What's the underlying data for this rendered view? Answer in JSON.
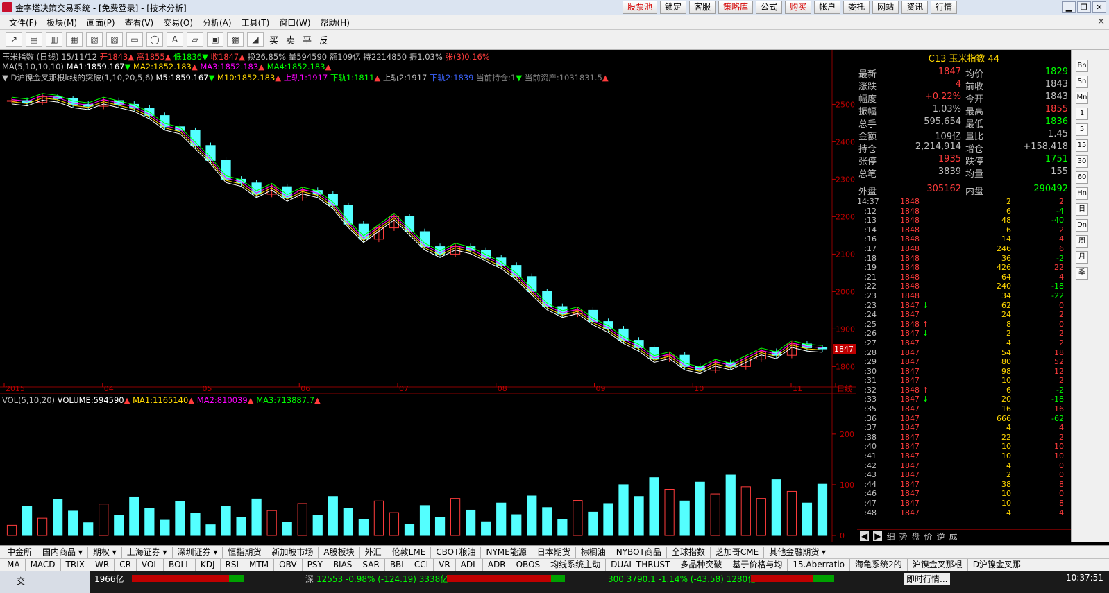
{
  "window": {
    "title": "金字塔决策交易系统 - [免费登录] - [技术分析]",
    "top_buttons": [
      {
        "label": "股票池",
        "red": true
      },
      {
        "label": "锁定",
        "red": false
      },
      {
        "label": "客服",
        "red": false
      },
      {
        "label": "策略库",
        "red": true
      },
      {
        "label": "公式",
        "red": false
      },
      {
        "label": "购买",
        "red": true
      },
      {
        "label": "帐户",
        "red": false
      },
      {
        "label": "委托",
        "red": false
      },
      {
        "label": "网站",
        "red": false
      },
      {
        "label": "资讯",
        "red": false
      },
      {
        "label": "行情",
        "red": false
      }
    ],
    "controls": [
      "▁",
      "❐",
      "✕"
    ]
  },
  "menu": [
    "文件(F)",
    "板块(M)",
    "画面(P)",
    "查看(V)",
    "交易(O)",
    "分析(A)",
    "工具(T)",
    "窗口(W)",
    "帮助(H)"
  ],
  "toolbar": {
    "trade_labels": [
      "买",
      "卖",
      "平",
      "反"
    ]
  },
  "chart_header": {
    "line1": [
      {
        "t": "玉米指数 (日线) 15/11/12 ",
        "c": "#c0c0c0"
      },
      {
        "t": "开1843",
        "c": "#ff3c3c"
      },
      {
        "t": "▲ ",
        "c": "#ff3c3c"
      },
      {
        "t": "高1855",
        "c": "#ff3c3c"
      },
      {
        "t": "▲ ",
        "c": "#ff3c3c"
      },
      {
        "t": "低1836",
        "c": "#00ff00"
      },
      {
        "t": "▼ ",
        "c": "#00ff00"
      },
      {
        "t": "收1847",
        "c": "#ff3c3c"
      },
      {
        "t": "▲ ",
        "c": "#ff3c3c"
      },
      {
        "t": "换26.85% 量594590 额109亿 持2214850 振1.03% ",
        "c": "#c0c0c0"
      },
      {
        "t": "张(3)0.16%",
        "c": "#ff3c3c"
      }
    ],
    "line2": [
      {
        "t": "MA(5,10,10,10) ",
        "c": "#c0c0c0"
      },
      {
        "t": "MA1:1859.167",
        "c": "#ffffff"
      },
      {
        "t": "▼ ",
        "c": "#00ff00"
      },
      {
        "t": "MA2:1852.183",
        "c": "#ffd700"
      },
      {
        "t": "▲ ",
        "c": "#ff3c3c"
      },
      {
        "t": "MA3:1852.183",
        "c": "#ff00ff"
      },
      {
        "t": "▲ ",
        "c": "#ff3c3c"
      },
      {
        "t": "MA4:1852.183",
        "c": "#00ff00"
      },
      {
        "t": "▲",
        "c": "#ff3c3c"
      }
    ],
    "line3": [
      {
        "t": "▼ D沪镍金叉那根k线的突破(1,10,20,5,6) ",
        "c": "#c0c0c0"
      },
      {
        "t": "M5:1859.167",
        "c": "#ffffff"
      },
      {
        "t": "▼ ",
        "c": "#00ff00"
      },
      {
        "t": "M10:1852.183",
        "c": "#ffd700"
      },
      {
        "t": "▲ ",
        "c": "#ff3c3c"
      },
      {
        "t": "上轨1:1917 ",
        "c": "#ff00ff"
      },
      {
        "t": "下轨1:1811",
        "c": "#00ff00"
      },
      {
        "t": "▲ ",
        "c": "#ff3c3c"
      },
      {
        "t": "上轨2:1917 ",
        "c": "#c0c0c0"
      },
      {
        "t": "下轨2:1839 ",
        "c": "#3c64ff"
      },
      {
        "t": "当前持仓:1",
        "c": "#808080"
      },
      {
        "t": "▼ ",
        "c": "#00ff00"
      },
      {
        "t": "当前资产:1031831.5",
        "c": "#808080"
      },
      {
        "t": "▲",
        "c": "#ff3c3c"
      }
    ],
    "vol_line": [
      {
        "t": "VOL(5,10,20) ",
        "c": "#c0c0c0"
      },
      {
        "t": "VOLUME:594590",
        "c": "#ffffff"
      },
      {
        "t": "▲ ",
        "c": "#ff3c3c"
      },
      {
        "t": "MA1:1165140",
        "c": "#ffd700"
      },
      {
        "t": "▲ ",
        "c": "#ff3c3c"
      },
      {
        "t": "MA2:810039",
        "c": "#ff00ff"
      },
      {
        "t": "▲ ",
        "c": "#ff3c3c"
      },
      {
        "t": "MA3:713887.7",
        "c": "#00ff00"
      },
      {
        "t": "▲",
        "c": "#ff3c3c"
      }
    ]
  },
  "chart_data": [
    {
      "type": "candlestick",
      "y_axis_labels": [
        "2500",
        "2400",
        "2300",
        "2200",
        "2100",
        "2000",
        "1900",
        "1800"
      ],
      "ylim": [
        1760,
        2560
      ],
      "x_axis_labels": [
        "2015",
        "04",
        "05",
        "06",
        "07",
        "08",
        "09",
        "10",
        "11",
        "日线"
      ],
      "last_price_tag": "1847",
      "series": [
        {
          "name": "MA1",
          "color": "#ffffff"
        },
        {
          "name": "MA2",
          "color": "#ffd700"
        },
        {
          "name": "MA3",
          "color": "#ff00ff"
        },
        {
          "name": "MA4",
          "color": "#00ff00"
        }
      ],
      "close_approx": [
        2510,
        2505,
        2520,
        2515,
        2500,
        2495,
        2510,
        2500,
        2490,
        2470,
        2440,
        2430,
        2390,
        2350,
        2300,
        2290,
        2260,
        2280,
        2250,
        2270,
        2260,
        2230,
        2180,
        2140,
        2170,
        2200,
        2160,
        2120,
        2100,
        2120,
        2110,
        2090,
        2070,
        2040,
        2000,
        1960,
        1940,
        1950,
        1920,
        1900,
        1870,
        1850,
        1820,
        1830,
        1800,
        1790,
        1810,
        1800,
        1820,
        1840,
        1830,
        1860,
        1850,
        1847
      ]
    },
    {
      "type": "bar",
      "y_axis_labels": [
        "200",
        "100",
        "0"
      ],
      "ylim": [
        0,
        260
      ]
    }
  ],
  "quote": {
    "header": "C13  玉米指数  44",
    "rows": [
      [
        "最新",
        "1847",
        "#ff3c3c",
        "均价",
        "1829",
        "#00ff00"
      ],
      [
        "涨跌",
        "4",
        "#ff3c3c",
        "前收",
        "1843",
        "#c0c0c0"
      ],
      [
        "幅度",
        "+0.22%",
        "#ff3c3c",
        "今开",
        "1843",
        "#c0c0c0"
      ],
      [
        "振幅",
        "1.03%",
        "#c0c0c0",
        "最高",
        "1855",
        "#ff3c3c"
      ],
      [
        "总手",
        "595,654",
        "#c0c0c0",
        "最低",
        "1836",
        "#00ff00"
      ],
      [
        "金额",
        "109亿",
        "#c0c0c0",
        "量比",
        "1.45",
        "#c0c0c0"
      ],
      [
        "持仓",
        "2,214,914",
        "#c0c0c0",
        "增仓",
        "+158,418",
        "#c0c0c0"
      ],
      [
        "张停",
        "1935",
        "#ff3c3c",
        "跌停",
        "1751",
        "#00ff00"
      ],
      [
        "总笔",
        "3839",
        "#c0c0c0",
        "均量",
        "155",
        "#c0c0c0"
      ]
    ],
    "outer_label": "外盘",
    "outer_value": "305162",
    "inner_label": "内盘",
    "inner_value": "290492"
  },
  "ticks": [
    [
      "14:37",
      "1848",
      "",
      "2",
      "2"
    ],
    [
      ":12",
      "1848",
      "",
      "6",
      "-4"
    ],
    [
      ":13",
      "1848",
      "",
      "48",
      "-40"
    ],
    [
      ":14",
      "1848",
      "",
      "6",
      "2"
    ],
    [
      ":16",
      "1848",
      "",
      "14",
      "4"
    ],
    [
      ":17",
      "1848",
      "",
      "246",
      "6"
    ],
    [
      ":18",
      "1848",
      "",
      "36",
      "-2"
    ],
    [
      ":19",
      "1848",
      "",
      "426",
      "22"
    ],
    [
      ":21",
      "1848",
      "",
      "64",
      "4"
    ],
    [
      ":22",
      "1848",
      "",
      "240",
      "-18"
    ],
    [
      ":23",
      "1848",
      "",
      "34",
      "-22"
    ],
    [
      ":23",
      "1847",
      "↓",
      "62",
      "0"
    ],
    [
      ":24",
      "1847",
      "",
      "24",
      "2"
    ],
    [
      ":25",
      "1848",
      "↑",
      "8",
      "0"
    ],
    [
      ":26",
      "1847",
      "↓",
      "2",
      "2"
    ],
    [
      ":27",
      "1847",
      "",
      "4",
      "2"
    ],
    [
      ":28",
      "1847",
      "",
      "54",
      "18"
    ],
    [
      ":29",
      "1847",
      "",
      "80",
      "52"
    ],
    [
      ":30",
      "1847",
      "",
      "98",
      "12"
    ],
    [
      ":31",
      "1847",
      "",
      "10",
      "2"
    ],
    [
      ":32",
      "1848",
      "↑",
      "6",
      "-2"
    ],
    [
      ":33",
      "1847",
      "↓",
      "20",
      "-18"
    ],
    [
      ":35",
      "1847",
      "",
      "16",
      "16"
    ],
    [
      ":36",
      "1847",
      "",
      "666",
      "-62"
    ],
    [
      ":37",
      "1847",
      "",
      "4",
      "4"
    ],
    [
      ":38",
      "1847",
      "",
      "22",
      "2"
    ],
    [
      ":40",
      "1847",
      "",
      "10",
      "10"
    ],
    [
      ":41",
      "1847",
      "",
      "10",
      "10"
    ],
    [
      ":42",
      "1847",
      "",
      "4",
      "0"
    ],
    [
      ":43",
      "1847",
      "",
      "2",
      "0"
    ],
    [
      ":44",
      "1847",
      "",
      "38",
      "8"
    ],
    [
      ":46",
      "1847",
      "",
      "10",
      "0"
    ],
    [
      ":47",
      "1847",
      "",
      "10",
      "8"
    ],
    [
      ":48",
      "1847",
      "",
      "4",
      "4"
    ]
  ],
  "right_tabs": [
    "◀",
    "▶",
    "细",
    "势",
    "盘",
    "价",
    "逆",
    "成"
  ],
  "side_icons": [
    "Bn",
    "Sn",
    "Mn",
    "1",
    "5",
    "15",
    "30",
    "60",
    "Hn",
    "日",
    "Dn",
    "周",
    "月",
    "季"
  ],
  "bottom_tabs_1": [
    "中金所",
    "国内商品 ▾",
    "期权 ▾",
    "上海证券 ▾",
    "深圳证券 ▾",
    "恒指期货",
    "新加坡市场",
    "A股板块",
    "外汇",
    "伦敦LME",
    "CBOT粮油",
    "NYME能源",
    "日本期货",
    "棕榈油",
    "NYBOT商品",
    "全球指数",
    "芝加哥CME",
    "其他金融期货 ▾"
  ],
  "bottom_tabs_2": [
    "MA",
    "MACD",
    "TRIX",
    "WR",
    "CR",
    "VOL",
    "BOLL",
    "KDJ",
    "RSI",
    "MTM",
    "OBV",
    "PSY",
    "BIAS",
    "SAR",
    "BBI",
    "CCI",
    "VR",
    "ADL",
    "ADR",
    "OBOS",
    "均线系统主动",
    "DUAL THRUST",
    "多品种突破",
    "基于价格与均",
    "15.Aberratio",
    "海龟系统2的",
    "沪镍金叉那根",
    "D沪镍金叉那"
  ],
  "status": {
    "task": "交",
    "amount1": "1966亿",
    "sh_label": "深",
    "sh_value": "12553 -0.98% (-124.19) 3338亿",
    "idx_value": "300 3790.1 -1.14% (-43.58) 1280亿",
    "news": "即时行情...",
    "time": "10:37:51"
  }
}
